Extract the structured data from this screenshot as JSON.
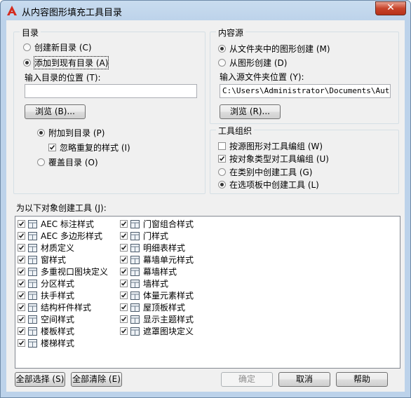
{
  "window": {
    "title": "从内容图形填充工具目录",
    "close_glyph": "✕"
  },
  "catalog": {
    "group_title": "目录",
    "create_new": "创建新目录 (C)",
    "add_existing": "添加到现有目录 (A)",
    "location_label": "输入目录的位置 (T):",
    "location_value": "",
    "browse": "浏览 (B)...",
    "append": "附加到目录 (P)",
    "ignore_dup": "忽略重复的样式 (I)",
    "overwrite": "覆盖目录 (O)"
  },
  "source": {
    "group_title": "内容源",
    "from_folder": "从文件夹中的图形创建 (M)",
    "from_drawing": "从图形创建 (D)",
    "folder_label": "输入源文件夹位置 (Y):",
    "folder_value": "C:\\Users\\Administrator\\Documents\\Autodesk",
    "browse": "浏览 (R)..."
  },
  "tool_org": {
    "group_title": "工具组织",
    "by_drawing": "按源图形对工具编组 (W)",
    "by_type": "按对象类型对工具编组 (U)",
    "in_category": "在类别中创建工具 (G)",
    "in_palette": "在选项板中创建工具 (L)"
  },
  "objects": {
    "label": "为以下对象创建工具 (J):",
    "col1": [
      {
        "label": "AEC 标注样式",
        "icon": "aec-dimension-icon"
      },
      {
        "label": "AEC 多边形样式",
        "icon": "aec-polygon-icon"
      },
      {
        "label": "材质定义",
        "icon": "material-icon"
      },
      {
        "label": "窗样式",
        "icon": "window-icon"
      },
      {
        "label": "多重视口图块定义",
        "icon": "multiview-block-icon"
      },
      {
        "label": "分区样式",
        "icon": "zone-icon"
      },
      {
        "label": "扶手样式",
        "icon": "railing-icon"
      },
      {
        "label": "结构杆件样式",
        "icon": "structural-member-icon"
      },
      {
        "label": "空间样式",
        "icon": "space-icon"
      },
      {
        "label": "楼板样式",
        "icon": "slab-icon"
      },
      {
        "label": "楼梯样式",
        "icon": "stair-icon"
      }
    ],
    "col2": [
      {
        "label": "门窗组合样式",
        "icon": "door-window-assembly-icon"
      },
      {
        "label": "门样式",
        "icon": "door-icon"
      },
      {
        "label": "明细表样式",
        "icon": "schedule-table-icon"
      },
      {
        "label": "幕墙单元样式",
        "icon": "curtain-wall-unit-icon"
      },
      {
        "label": "幕墙样式",
        "icon": "curtain-wall-icon"
      },
      {
        "label": "墙样式",
        "icon": "wall-icon"
      },
      {
        "label": "体量元素样式",
        "icon": "mass-element-icon"
      },
      {
        "label": "屋顶板样式",
        "icon": "roof-slab-icon"
      },
      {
        "label": "显示主题样式",
        "icon": "display-theme-icon"
      },
      {
        "label": "遮罩图块定义",
        "icon": "mask-block-icon"
      }
    ]
  },
  "buttons": {
    "select_all": "全部选择 (S)",
    "clear_all": "全部清除 (E)",
    "ok": "确定",
    "cancel": "取消",
    "help": "帮助"
  }
}
